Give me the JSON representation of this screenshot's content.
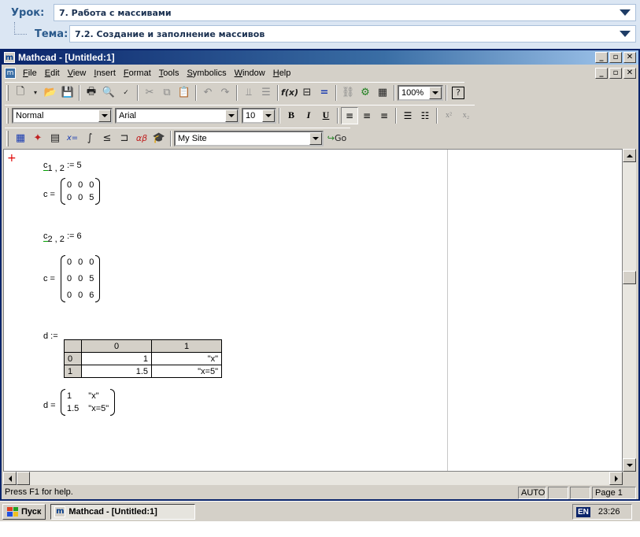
{
  "lesson": {
    "lesson_label": "Урок:",
    "lesson_value": "7. Работа с массивами",
    "topic_label": "Тема:",
    "topic_value": "7.2. Создание и заполнение массивов"
  },
  "window": {
    "app_icon": "m",
    "title": "Mathcad - [Untitled:1]",
    "minimize": "_",
    "restore": "▫",
    "close": "✕"
  },
  "menubar": {
    "doc_icon": "m",
    "items": [
      "File",
      "Edit",
      "View",
      "Insert",
      "Format",
      "Tools",
      "Symbolics",
      "Window",
      "Help"
    ]
  },
  "toolbar_standard": {
    "zoom": "100%",
    "icons": [
      "new-icon",
      "open-icon",
      "save-icon",
      "print-icon",
      "print-preview-icon",
      "spell-check-icon",
      "cut-icon",
      "copy-icon",
      "paste-icon",
      "undo-icon",
      "redo-icon",
      "align-across-icon",
      "align-down-icon",
      "insert-function-icon",
      "insert-unit-icon",
      "calculate-icon",
      "insert-hyperlink-icon",
      "component-wizard-icon",
      "resource-center-icon",
      "help-icon"
    ]
  },
  "toolbar_formatting": {
    "style": "Normal",
    "font": "Arial",
    "size": "10",
    "bold": "B",
    "italic": "I",
    "underline": "U"
  },
  "toolbar_math": {
    "site": "My Site",
    "go": "Go"
  },
  "worksheet": {
    "assign1": {
      "var": "c",
      "sub": "1 , 2",
      "op": ":=",
      "val": "5"
    },
    "eval1": {
      "lhs": "c =",
      "rows": [
        [
          "0",
          "0",
          "0"
        ],
        [
          "0",
          "0",
          "5"
        ]
      ]
    },
    "assign2": {
      "var": "c",
      "sub": "2 , 2",
      "op": ":=",
      "val": "6"
    },
    "eval2": {
      "lhs": "c =",
      "rows": [
        [
          "0",
          "0",
          "0"
        ],
        [
          "0",
          "0",
          "5"
        ],
        [
          "0",
          "0",
          "6"
        ]
      ]
    },
    "d_assign": {
      "lhs": "d :=",
      "col_headers": [
        "0",
        "1"
      ],
      "row_headers": [
        "0",
        "1"
      ],
      "rows": [
        [
          "1",
          "\"x\""
        ],
        [
          "1.5",
          "\"x=5\""
        ]
      ]
    },
    "d_eval": {
      "lhs": "d =",
      "rows": [
        [
          "1",
          "\"x\""
        ],
        [
          "1.5",
          "\"x=5\""
        ]
      ]
    }
  },
  "statusbar": {
    "help": "Press F1 for help.",
    "mode": "AUTO",
    "page": "Page 1"
  },
  "taskbar": {
    "start": "Пуск",
    "task": "Mathcad - [Untitled:1]",
    "lang": "EN",
    "clock": "23:26"
  }
}
